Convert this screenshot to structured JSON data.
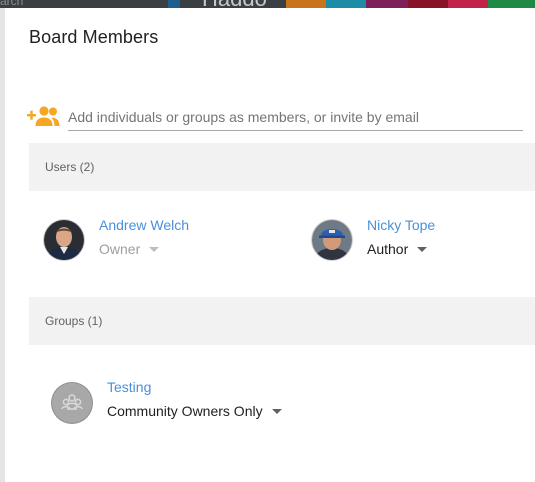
{
  "background": {
    "search_fragment": "arch",
    "logo_fragment": "Haddo",
    "tile_colors": [
      "#1f5f8f",
      "#3a3f44",
      "#c9741a",
      "#1f8ca7",
      "#7e1f59",
      "#8a1226",
      "#c2214a",
      "#1e8a43"
    ]
  },
  "dialog": {
    "title": "Board Members"
  },
  "add_member": {
    "icon": "person-add-icon",
    "placeholder": "Add individuals or groups as members, or invite by email",
    "icon_color": "#f5a623"
  },
  "users_section": {
    "header": "Users (2)",
    "members": [
      {
        "name": "Andrew Welch",
        "role": "Owner",
        "role_editable": false
      },
      {
        "name": "Nicky Tope",
        "role": "Author",
        "role_editable": true
      }
    ]
  },
  "groups_section": {
    "header": "Groups (1)",
    "members": [
      {
        "name": "Testing",
        "role": "Community Owners Only",
        "role_editable": true,
        "icon": "group-icon"
      }
    ]
  },
  "colors": {
    "link": "#4a90d9",
    "section_bg": "#f2f2f2",
    "accent": "#f5a623"
  }
}
